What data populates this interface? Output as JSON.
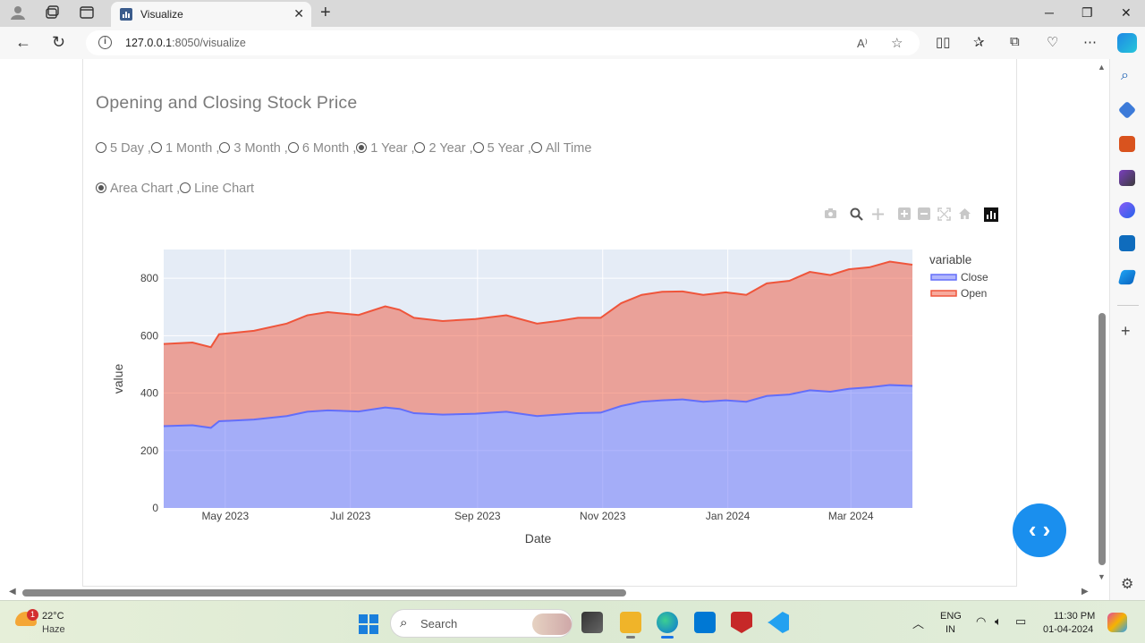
{
  "browser": {
    "tab_title": "Visualize",
    "url_host": "127.0.0.1",
    "url_path": ":8050/visualize"
  },
  "page": {
    "heading": "Opening and Closing Stock Price",
    "range_options": [
      {
        "label": "5 Day ,",
        "selected": false
      },
      {
        "label": "1 Month ,",
        "selected": false
      },
      {
        "label": "3 Month ,",
        "selected": false
      },
      {
        "label": "6 Month ,",
        "selected": false
      },
      {
        "label": "1 Year ,",
        "selected": true
      },
      {
        "label": "2 Year ,",
        "selected": false
      },
      {
        "label": "5 Year ,",
        "selected": false
      },
      {
        "label": "All Time",
        "selected": false
      }
    ],
    "chart_options": [
      {
        "label": "Area Chart ,",
        "selected": true
      },
      {
        "label": "Line Chart",
        "selected": false
      }
    ]
  },
  "chart_data": {
    "type": "area",
    "stacked": true,
    "title": "",
    "xlabel": "Date",
    "ylabel": "value",
    "legend_title": "variable",
    "legend_position": "right",
    "ylim": [
      0,
      900
    ],
    "yticks": [
      0,
      200,
      400,
      600,
      800
    ],
    "xlim": [
      "2023-04-01",
      "2024-03-31"
    ],
    "xticks": [
      {
        "date": "2023-05-01",
        "label": "May 2023"
      },
      {
        "date": "2023-07-01",
        "label": "Jul 2023"
      },
      {
        "date": "2023-09-01",
        "label": "Sep 2023"
      },
      {
        "date": "2023-11-01",
        "label": "Nov 2023"
      },
      {
        "date": "2024-01-01",
        "label": "Jan 2024"
      },
      {
        "date": "2024-03-01",
        "label": "Mar 2024"
      }
    ],
    "x": [
      "2023-04-01",
      "2023-04-15",
      "2023-04-24",
      "2023-04-28",
      "2023-05-15",
      "2023-05-31",
      "2023-06-10",
      "2023-06-20",
      "2023-07-05",
      "2023-07-18",
      "2023-07-25",
      "2023-08-01",
      "2023-08-15",
      "2023-08-31",
      "2023-09-15",
      "2023-09-30",
      "2023-10-10",
      "2023-10-20",
      "2023-10-31",
      "2023-11-10",
      "2023-11-20",
      "2023-11-30",
      "2023-12-10",
      "2023-12-20",
      "2023-12-31",
      "2024-01-10",
      "2024-01-20",
      "2024-01-31",
      "2024-02-10",
      "2024-02-20",
      "2024-02-29",
      "2024-03-10",
      "2024-03-20",
      "2024-03-31"
    ],
    "series": [
      {
        "name": "Close",
        "color": "#636efa",
        "values": [
          285,
          288,
          279,
          302,
          308,
          320,
          335,
          340,
          336,
          350,
          345,
          330,
          325,
          328,
          335,
          320,
          325,
          330,
          332,
          355,
          370,
          375,
          378,
          370,
          375,
          370,
          390,
          395,
          410,
          405,
          415,
          420,
          428,
          425
        ]
      },
      {
        "name": "Open",
        "color": "#ef553b",
        "values": [
          286,
          288,
          281,
          303,
          309,
          322,
          336,
          342,
          336,
          352,
          345,
          332,
          326,
          330,
          336,
          322,
          326,
          332,
          330,
          358,
          372,
          378,
          376,
          372,
          376,
          372,
          392,
          396,
          412,
          406,
          416,
          418,
          430,
          422
        ]
      }
    ]
  },
  "plot_modebar": [
    "camera-icon",
    "zoom-icon",
    "pan-icon",
    "zoom-in-icon",
    "zoom-out-icon",
    "autoscale-icon",
    "home-icon",
    "plotly-logo"
  ],
  "taskbar": {
    "temperature": "22°C",
    "condition": "Haze",
    "weather_badge": "1",
    "search_label": "Search",
    "lang_top": "ENG",
    "lang_bottom": "IN",
    "time": "11:30 PM",
    "date": "01-04-2024"
  },
  "colors": {
    "accent": "#1a8fee",
    "close": "#636efa",
    "open": "#ef553b"
  }
}
